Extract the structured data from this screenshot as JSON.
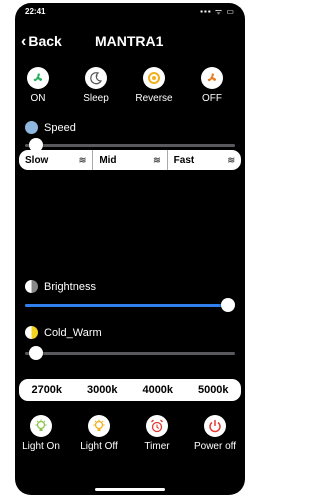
{
  "status": {
    "time": "22:41",
    "signal": "▪▪▪ ᯤ ▭"
  },
  "nav": {
    "back_label": "Back",
    "title": "MANTRA1"
  },
  "modes": [
    {
      "label": "ON",
      "icon": "fan-icon",
      "color": "#27ae60"
    },
    {
      "label": "Sleep",
      "icon": "sleep-icon",
      "color": "#555555"
    },
    {
      "label": "Reverse",
      "icon": "reverse-icon",
      "color": "#f2b01e"
    },
    {
      "label": "OFF",
      "icon": "fan-icon",
      "color": "#e67e22"
    }
  ],
  "speed": {
    "label": "Speed",
    "value": 0.02
  },
  "speed_options": [
    {
      "label": "Slow"
    },
    {
      "label": "Mid"
    },
    {
      "label": "Fast"
    }
  ],
  "brightness": {
    "label": "Brightness",
    "value": 1.0,
    "color": "#2f80ed"
  },
  "cold_warm": {
    "label": "Cold_Warm",
    "value": 0.02
  },
  "cct_options": [
    "2700k",
    "3000k",
    "4000k",
    "5000k"
  ],
  "light_buttons": [
    {
      "label": "Light On",
      "icon": "bulb-on-icon",
      "color": "#8bc34a"
    },
    {
      "label": "Light Off",
      "icon": "bulb-off-icon",
      "color": "#f2b01e"
    },
    {
      "label": "Timer",
      "icon": "alarm-clock-icon",
      "color": "#e53935"
    },
    {
      "label": "Power off",
      "icon": "power-icon",
      "color": "#e53935"
    }
  ]
}
